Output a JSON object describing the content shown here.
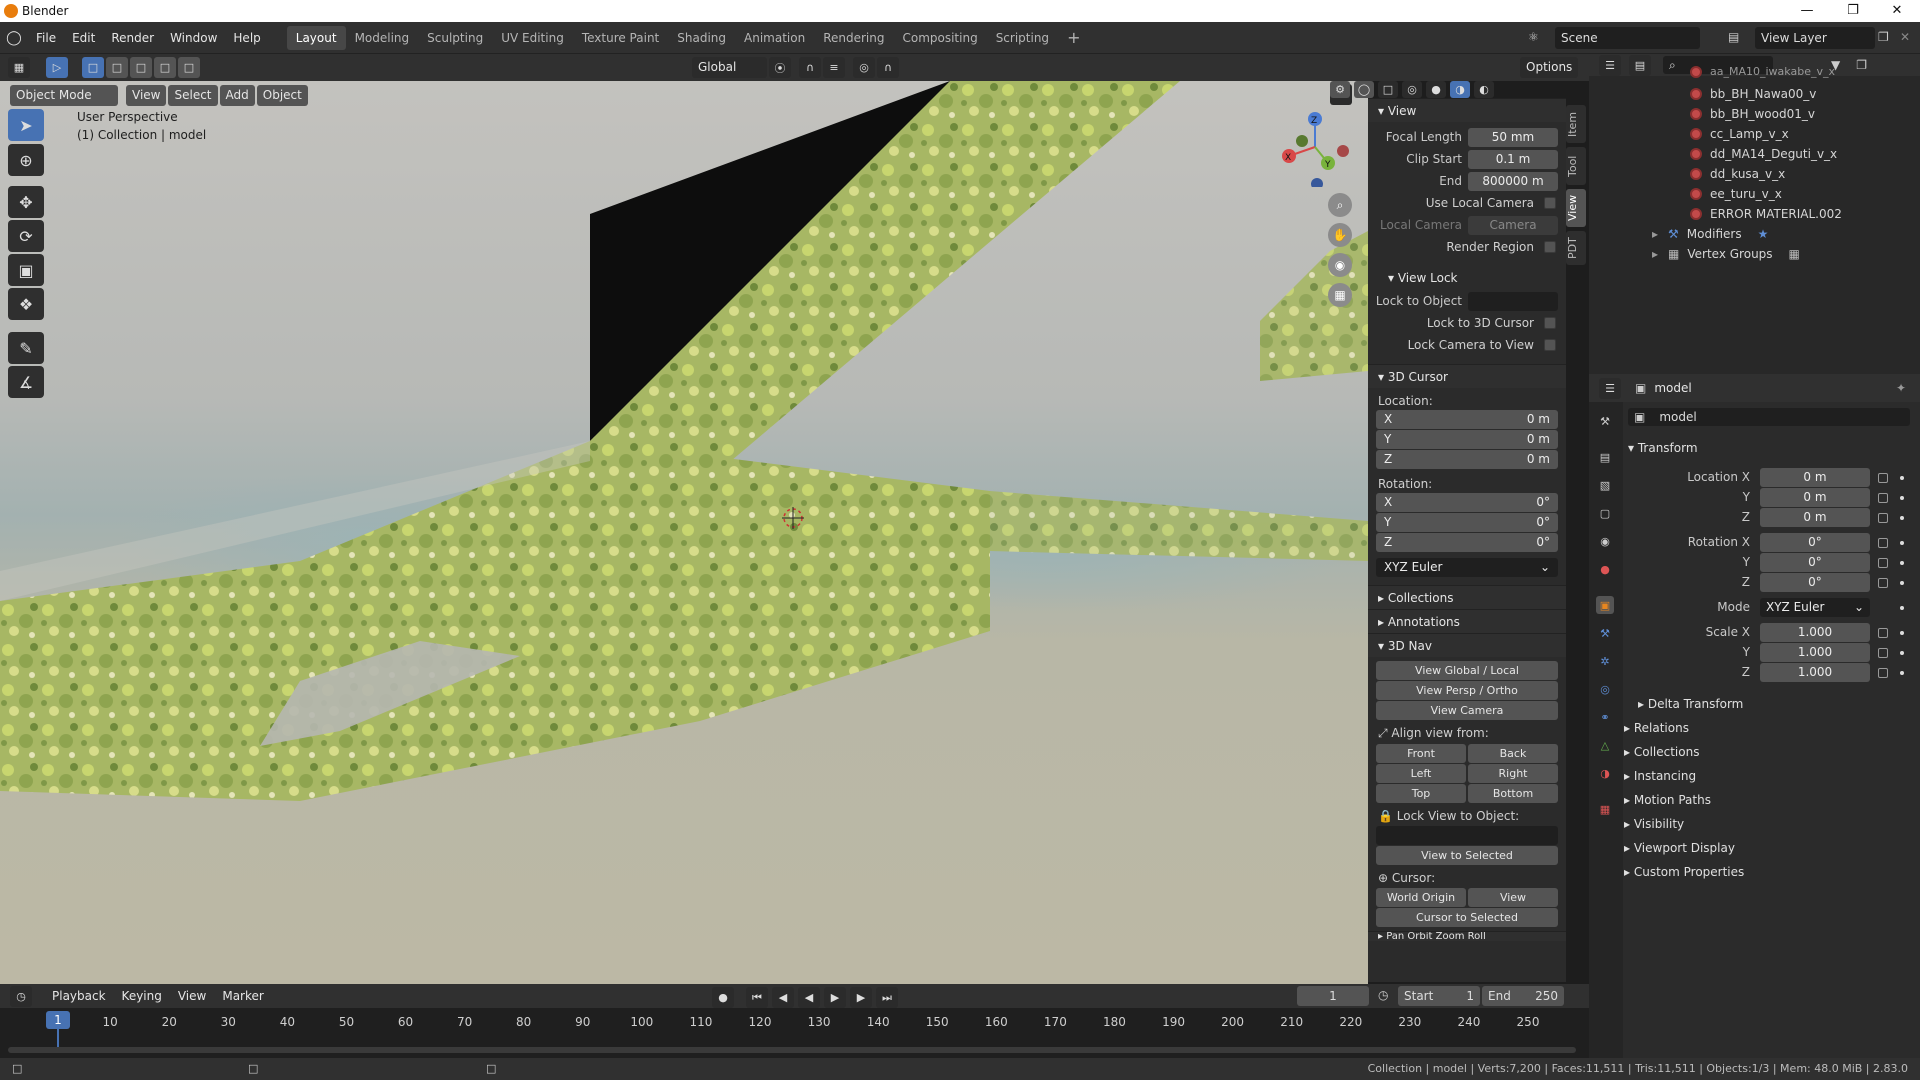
{
  "window": {
    "title": "Blender"
  },
  "menus": [
    "File",
    "Edit",
    "Render",
    "Window",
    "Help"
  ],
  "workspaces": [
    "Layout",
    "Modeling",
    "Sculpting",
    "UV Editing",
    "Texture Paint",
    "Shading",
    "Animation",
    "Rendering",
    "Compositing",
    "Scripting"
  ],
  "active_workspace": "Layout",
  "scene": {
    "name": "Scene",
    "view_layer": "View Layer"
  },
  "viewport_header": {
    "mode": "Object Mode",
    "menus": [
      "View",
      "Select",
      "Add",
      "Object"
    ],
    "orientation": "Global",
    "options": "Options"
  },
  "viewport_info": {
    "perspective": "User Perspective",
    "collection": "(1) Collection | model"
  },
  "gizmo": {
    "x": "X",
    "y": "Y",
    "z": "Z"
  },
  "npanel": {
    "tabs": [
      "Item",
      "Tool",
      "View",
      "PDT"
    ],
    "view": {
      "title": "View",
      "focal_length_label": "Focal Length",
      "focal_length": "50 mm",
      "clip_start_label": "Clip Start",
      "clip_start": "0.1 m",
      "clip_end_label": "End",
      "clip_end": "800000 m",
      "use_local_camera": "Use Local Camera",
      "local_camera_label": "Local Camera",
      "local_camera": "Camera",
      "render_region": "Render Region"
    },
    "view_lock": {
      "title": "View Lock",
      "lock_to_object": "Lock to Object",
      "lock_3d_cursor": "Lock to 3D Cursor",
      "lock_camera": "Lock Camera to View"
    },
    "cursor3d": {
      "title": "3D Cursor",
      "location_label": "Location:",
      "loc": [
        {
          "axis": "X",
          "value": "0 m"
        },
        {
          "axis": "Y",
          "value": "0 m"
        },
        {
          "axis": "Z",
          "value": "0 m"
        }
      ],
      "rotation_label": "Rotation:",
      "rot": [
        {
          "axis": "X",
          "value": "0°"
        },
        {
          "axis": "Y",
          "value": "0°"
        },
        {
          "axis": "Z",
          "value": "0°"
        }
      ],
      "mode": "XYZ Euler"
    },
    "collections": "Collections",
    "annotations": "Annotations",
    "nav3d": {
      "title": "3D Nav",
      "global_local": "View Global / Local",
      "persp_ortho": "View Persp / Ortho",
      "camera": "View Camera",
      "align_label": "Align view from:",
      "front": "Front",
      "back": "Back",
      "left": "Left",
      "right": "Right",
      "top": "Top",
      "bottom": "Bottom",
      "lock_view_label": "Lock View to Object:",
      "view_selected": "View to Selected",
      "cursor_label": "Cursor:",
      "world_origin": "World Origin",
      "view": "View",
      "cursor_selected": "Cursor to Selected",
      "pan_orbit": "Pan Orbit Zoom Roll"
    }
  },
  "outliner": {
    "items": [
      "aa_MA10_iwakabe_v_x",
      "bb_BH_Nawa00_v",
      "bb_BH_wood01_v",
      "cc_Lamp_v_x",
      "dd_MA14_Deguti_v_x",
      "dd_kusa_v_x",
      "ee_turu_v_x",
      "ERROR MATERIAL.002"
    ],
    "modifiers": "Modifiers",
    "vertex_groups": "Vertex Groups"
  },
  "properties": {
    "object_name": "model",
    "data_name": "model",
    "transform_title": "Transform",
    "location_label": "Location X",
    "location": [
      "0 m",
      "0 m",
      "0 m"
    ],
    "rotation_label": "Rotation X",
    "rotation": [
      "0°",
      "0°",
      "0°"
    ],
    "mode_label": "Mode",
    "mode": "XYZ Euler",
    "scale_label": "Scale X",
    "scale": [
      "1.000",
      "1.000",
      "1.000"
    ],
    "y_label": "Y",
    "z_label": "Z",
    "delta_transform": "Delta Transform",
    "sections": [
      "Relations",
      "Collections",
      "Instancing",
      "Motion Paths",
      "Visibility",
      "Viewport Display",
      "Custom Properties"
    ]
  },
  "timeline": {
    "menus": [
      "Playback",
      "Keying",
      "View",
      "Marker"
    ],
    "current_frame": "1",
    "start_label": "Start",
    "start": "1",
    "end_label": "End",
    "end": "250",
    "ticks": [
      "1",
      "10",
      "20",
      "30",
      "40",
      "50",
      "60",
      "70",
      "80",
      "90",
      "100",
      "110",
      "120",
      "130",
      "140",
      "150",
      "160",
      "170",
      "180",
      "190",
      "200",
      "210",
      "220",
      "230",
      "240",
      "250"
    ]
  },
  "status": "Collection | model | Verts:7,200 | Faces:11,511 | Tris:11,511 | Objects:1/3 | Mem: 48.0 MiB | 2.83.0"
}
